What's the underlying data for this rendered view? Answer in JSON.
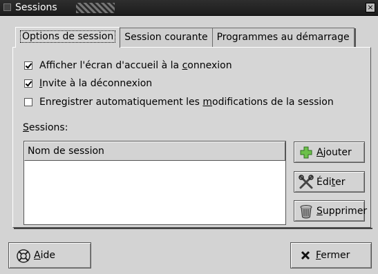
{
  "window": {
    "title": "Sessions",
    "close_glyph": "×"
  },
  "tabs": [
    {
      "label": "Options de session",
      "active": true
    },
    {
      "label": "Session courante",
      "active": false
    },
    {
      "label": "Programmes au démarrage",
      "active": false
    }
  ],
  "options": [
    {
      "pre": "Afficher l'écran d'accueil à la ",
      "mn": "c",
      "post": "onnexion",
      "checked": true
    },
    {
      "pre": "",
      "mn": "I",
      "post": "nvite à la déconnexion",
      "checked": true
    },
    {
      "pre": "Enregistrer automatiquement les ",
      "mn": "m",
      "post": "odifications de la session",
      "checked": false
    }
  ],
  "sessions": {
    "label_mn": "S",
    "label_rest": "essions:",
    "column_header": "Nom de session",
    "rows": []
  },
  "buttons": {
    "add": {
      "pre": "",
      "mn": "A",
      "post": "jouter",
      "icon": "plus-icon"
    },
    "edit": {
      "pre": "Édi",
      "mn": "t",
      "post": "er",
      "icon": "tools-icon"
    },
    "delete": {
      "pre": "",
      "mn": "S",
      "post": "upprimer",
      "icon": "trash-icon"
    },
    "help": {
      "pre": "",
      "mn": "A",
      "post": "ide",
      "icon": "lifebuoy-icon"
    },
    "close": {
      "pre": "",
      "mn": "F",
      "post": "ermer",
      "icon": "x-icon"
    }
  },
  "colors": {
    "titlebar": "#1c1c1c",
    "dialog": "#d3d3d3",
    "list_bg": "#ffffff",
    "add_icon": "#4a9a3a"
  }
}
